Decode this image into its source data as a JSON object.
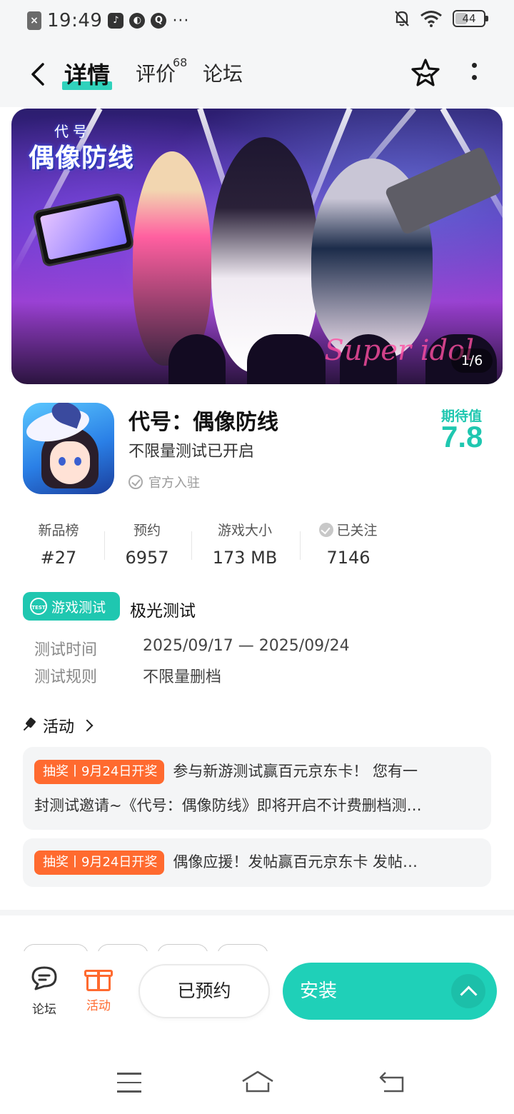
{
  "status_bar": {
    "time": "19:49",
    "dots": "···",
    "battery": "44"
  },
  "nav": {
    "tabs": [
      {
        "label": "详情"
      },
      {
        "label": "评价",
        "badge": "68"
      },
      {
        "label": "论坛"
      }
    ]
  },
  "banner": {
    "title_logo": "偶像防线",
    "title_prefix": "代号",
    "script_text": "Super idol",
    "counter": "1/6"
  },
  "game": {
    "title": "代号：偶像防线",
    "subtitle": "不限量测试已开启",
    "official": "官方入驻",
    "expect_label": "期待值",
    "expect_score": "7.8"
  },
  "stats": [
    {
      "label": "新品榜",
      "value": "#27"
    },
    {
      "label": "预约",
      "value": "6957"
    },
    {
      "label": "游戏大小",
      "value": "173 MB"
    },
    {
      "label": "已关注",
      "value": "7146"
    }
  ],
  "test": {
    "badge": "游戏测试",
    "badge_icon_text": "TEST",
    "name": "极光测试",
    "rows": [
      {
        "label": "测试时间",
        "value": "2025/09/17 — 2025/09/24"
      },
      {
        "label": "测试规则",
        "value": "不限量删档"
      }
    ]
  },
  "activity": {
    "title": "活动",
    "items": [
      {
        "tag": "抽奖丨9月24日开奖",
        "line1": "参与新游测试赢百元京东卡！ 您有一",
        "line2": "封测试邀请~《代号：偶像防线》即将开启不计费删档测…"
      },
      {
        "tag": "抽奖丨9月24日开奖",
        "line1": "偶像应援！发帖赢百元京东卡 发帖…"
      }
    ]
  },
  "bottom_bar": {
    "forum": "论坛",
    "activity": "活动",
    "reserved": "已预约",
    "install": "安装"
  },
  "colors": {
    "accent": "#1fc7b0",
    "lottery": "#ff6a2f"
  }
}
